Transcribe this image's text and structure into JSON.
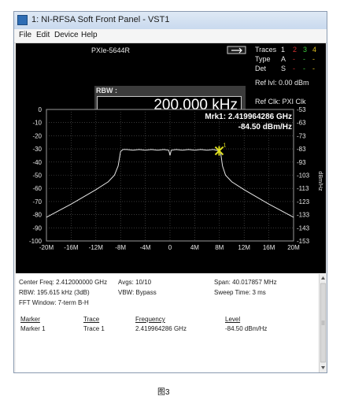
{
  "window": {
    "title": "1: NI-RFSA Soft Front Panel - VST1"
  },
  "menu": [
    "File",
    "Edit",
    "Device",
    "Help"
  ],
  "panel": {
    "device": "PXIe-5644R",
    "rbw_label": "RBW :",
    "rbw_value": "200.000 kHz",
    "traces_label": "Traces",
    "trace_numbers": [
      "1",
      "2",
      "3",
      "4"
    ],
    "trace_colors": [
      "#e8e8e8",
      "#d23030",
      "#3cc83c",
      "#e0c020"
    ],
    "type_label": "Type",
    "type_values": [
      "A",
      "-",
      "-",
      "-"
    ],
    "det_label": "Det",
    "det_values": [
      "S",
      "-",
      "-",
      "-"
    ],
    "ref_lvl": "Ref lvl: 0.00 dBm",
    "ref_clk": "Ref Clk: PXI Clk"
  },
  "chart_data": {
    "type": "line",
    "left_unit": "dBm",
    "right_unit": "dBm/Hz",
    "left_ticks": [
      "0",
      "-10",
      "-20",
      "-30",
      "-40",
      "-50",
      "-60",
      "-70",
      "-80",
      "-90",
      "-100"
    ],
    "right_ticks": [
      "-53",
      "-63",
      "-73",
      "-83",
      "-93",
      "-103",
      "-113",
      "-123",
      "-133",
      "-143",
      "-153"
    ],
    "x_ticks": [
      "-20M",
      "-16M",
      "-12M",
      "-8M",
      "-4M",
      "0",
      "4M",
      "8M",
      "12M",
      "16M",
      "20M"
    ],
    "xlim": [
      -20,
      20
    ],
    "ylim": [
      -100,
      0
    ],
    "grid": true,
    "marker_label": "Mrk1: 2.419964286 GHz",
    "marker_value": "-84.50 dBm/Hz",
    "marker_number": "1",
    "marker_point": {
      "x": 7.96,
      "y": -31.5
    },
    "series": [
      {
        "color": "#e8e8e8",
        "points": [
          [
            -20,
            -82
          ],
          [
            -18,
            -77
          ],
          [
            -16,
            -72
          ],
          [
            -14,
            -66.5
          ],
          [
            -12,
            -61
          ],
          [
            -10,
            -55
          ],
          [
            -9,
            -50
          ],
          [
            -8.4,
            -43
          ],
          [
            -8,
            -32
          ],
          [
            -7.6,
            -30.5
          ],
          [
            -7,
            -30.5
          ],
          [
            -6,
            -31
          ],
          [
            -5,
            -30.5
          ],
          [
            -4,
            -31
          ],
          [
            -3,
            -30.5
          ],
          [
            -2,
            -31
          ],
          [
            -1,
            -30.5
          ],
          [
            -0.2,
            -31
          ],
          [
            0,
            -35
          ],
          [
            0.2,
            -31
          ],
          [
            1,
            -30.5
          ],
          [
            2,
            -31
          ],
          [
            3,
            -30.5
          ],
          [
            4,
            -31
          ],
          [
            5,
            -30.5
          ],
          [
            6,
            -31
          ],
          [
            7,
            -30.5
          ],
          [
            7.96,
            -31.5
          ],
          [
            8.2,
            -33
          ],
          [
            8.5,
            -43
          ],
          [
            9,
            -50
          ],
          [
            10,
            -55
          ],
          [
            12,
            -61
          ],
          [
            14,
            -66.5
          ],
          [
            16,
            -72
          ],
          [
            18,
            -77
          ],
          [
            20,
            -82
          ]
        ]
      }
    ]
  },
  "status": {
    "center_freq": "Center Freq: 2.412000000 GHz",
    "avgs": "Avgs: 10/10",
    "span": "Span: 40.017857 MHz",
    "rbw": "RBW: 195.615 kHz (3dB)",
    "vbw": "VBW: Bypass",
    "sweep_time": "Sweep Time: 3 ms",
    "fft_window": "FFT Window: 7-term B-H",
    "table_headers": [
      "Marker",
      "Trace",
      "Frequency",
      "Level"
    ],
    "table_row": [
      "Marker 1",
      "Trace 1",
      "2.419964286 GHz",
      "-84.50 dBm/Hz"
    ]
  },
  "caption": "图3"
}
